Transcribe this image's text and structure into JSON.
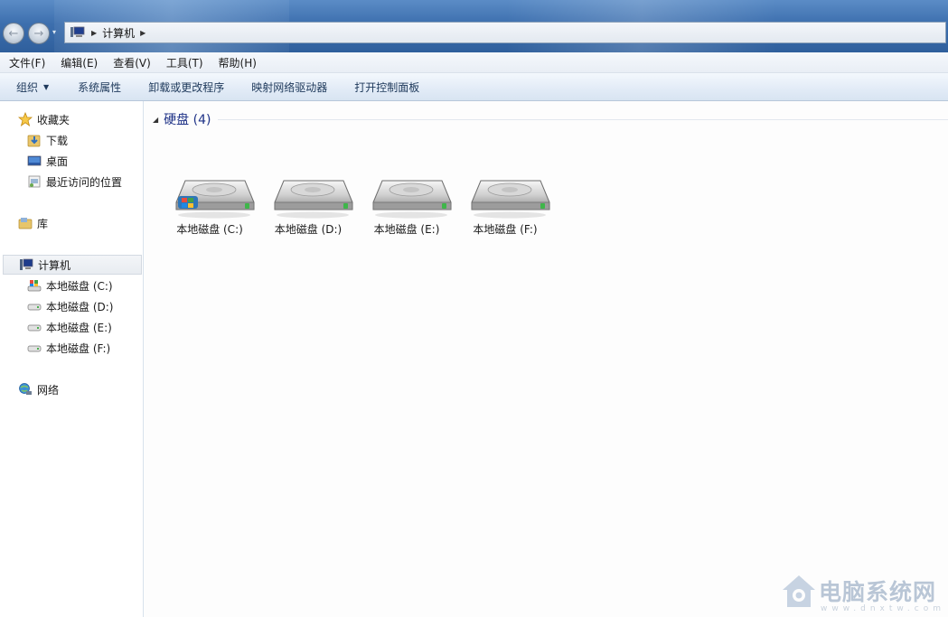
{
  "address": {
    "path": "计算机"
  },
  "menu": [
    "文件(F)",
    "编辑(E)",
    "查看(V)",
    "工具(T)",
    "帮助(H)"
  ],
  "toolbar": {
    "organize": "组织",
    "system_properties": "系统属性",
    "uninstall": "卸载或更改程序",
    "map_drive": "映射网络驱动器",
    "control_panel": "打开控制面板"
  },
  "sidebar": {
    "favorites": "收藏夹",
    "downloads": "下载",
    "desktop": "桌面",
    "recent": "最近访问的位置",
    "libraries": "库",
    "computer": "计算机",
    "drives": [
      "本地磁盘 (C:)",
      "本地磁盘 (D:)",
      "本地磁盘 (E:)",
      "本地磁盘 (F:)"
    ],
    "network": "网络"
  },
  "content": {
    "group_title": "硬盘 (4)",
    "drives": [
      "本地磁盘 (C:)",
      "本地磁盘 (D:)",
      "本地磁盘 (E:)",
      "本地磁盘 (F:)"
    ]
  },
  "watermark": {
    "title": "电脑系统网",
    "sub": "www.dnxtw.com"
  }
}
